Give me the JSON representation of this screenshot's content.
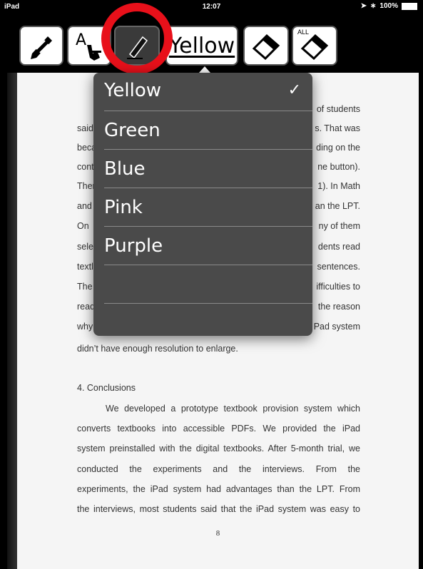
{
  "status_bar": {
    "device": "iPad",
    "time": "12:07",
    "battery": "100%"
  },
  "toolbar": {
    "pen_icon": "pen-icon",
    "select_text_icon": "text-select-icon",
    "highlighter_icon": "highlighter-icon",
    "color_label": "Yellow",
    "eraser_icon": "eraser-icon",
    "erase_all_label": "ALL",
    "highlight_color": "#e8101a"
  },
  "color_menu": {
    "items": [
      {
        "label": "Yellow",
        "selected": true
      },
      {
        "label": "Green",
        "selected": false
      },
      {
        "label": "Blue",
        "selected": false
      },
      {
        "label": "Pink",
        "selected": false
      },
      {
        "label": "Purple",
        "selected": false
      },
      {
        "label": "",
        "selected": false
      },
      {
        "label": "",
        "selected": false
      }
    ],
    "check_mark": "✓"
  },
  "document": {
    "left_fragments": [
      "said",
      "beca",
      "cont",
      "Ther",
      "and",
      "On",
      "sele",
      "textl",
      "The",
      "read",
      "why"
    ],
    "right_fragments": [
      "of students",
      "s. That was",
      "ding on the",
      "ne button).",
      "1). In Math",
      "an the LPT.",
      "ny of them",
      "dents read",
      "sentences.",
      "ifficulties to",
      "the reason",
      "Pad system"
    ],
    "line_after_menu": "didn’t have enough resolution to enlarge.",
    "section_heading": "4. Conclusions",
    "conclusion_lines": [
      "We developed a prototype textbook provision system which",
      "converts textbooks into accessible PDFs. We provided the iPad",
      "system preinstalled with the digital textbooks. After 5-month trial, we",
      "conducted the experiments and the interviews. From the",
      "experiments, the iPad system had advantages than the LPT. From",
      "the interviews, most students said that the iPad system was easy to"
    ],
    "page_number": "8"
  }
}
